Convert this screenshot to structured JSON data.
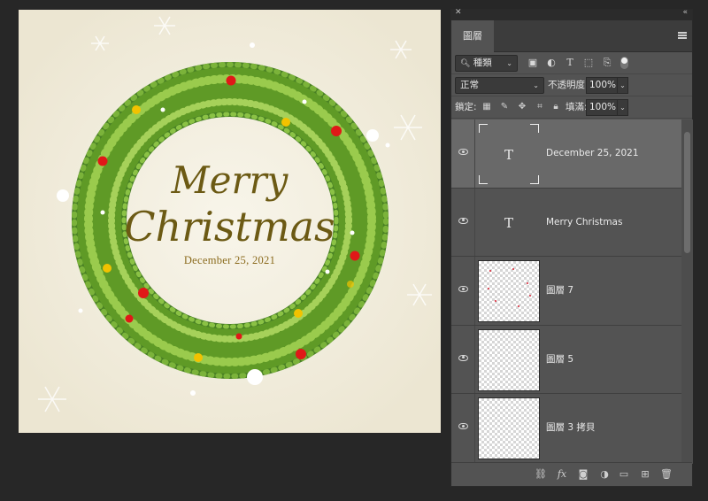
{
  "canvas": {
    "title_line1": "Merry",
    "title_line2": "Christmas",
    "date": "December 25, 2021"
  },
  "panel": {
    "tab": "圖層",
    "filter_label": "種類",
    "blend_mode": "正常",
    "opacity_label": "不透明度:",
    "opacity_value": "100%",
    "lock_label": "鎖定:",
    "fill_label": "填滿:",
    "fill_value": "100%",
    "layers": [
      {
        "name": "December 25, 2021",
        "kind": "text",
        "selected": true
      },
      {
        "name": "Merry Christmas",
        "kind": "text",
        "selected": false
      },
      {
        "name": "圖層 7",
        "kind": "image",
        "selected": false
      },
      {
        "name": "圖層 5",
        "kind": "image",
        "selected": false
      },
      {
        "name": "圖層 3 拷貝",
        "kind": "image",
        "selected": false
      }
    ],
    "text_thumb_glyph": "T"
  },
  "colors": {
    "canvas_bg": "#f3efe0",
    "wreath_green": "#6ea32a",
    "berry_red": "#e01818",
    "berry_yellow": "#f2c200",
    "title_color": "#6c5a14",
    "panel_bg": "#535353",
    "selected_layer": "#696969"
  },
  "icons": [
    "close-icon",
    "collapse-icon",
    "panel-menu-icon",
    "image-filter-icon",
    "adjustment-filter-icon",
    "type-filter-icon",
    "shape-filter-icon",
    "smart-object-filter-icon",
    "filter-toggle-icon",
    "lock-transparent-icon",
    "lock-paint-icon",
    "lock-move-icon",
    "lock-artboard-icon",
    "lock-all-icon",
    "eye-icon",
    "link-icon",
    "fx-icon",
    "mask-icon",
    "adjustment-layer-icon",
    "folder-icon",
    "new-layer-icon",
    "trash-icon"
  ]
}
